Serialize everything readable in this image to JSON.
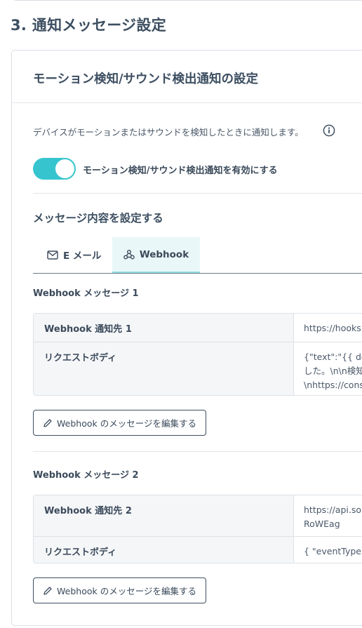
{
  "section": {
    "title": "3. 通知メッセージ設定"
  },
  "card": {
    "title": "モーション検知/サウンド検出通知の設定",
    "description": "デバイスがモーションまたはサウンドを検知したときに通知します。",
    "toggle": {
      "label": "モーション検知/サウンド検出通知を有効にする",
      "enabled": true
    },
    "message_heading": "メッセージ内容を設定する",
    "tabs": [
      {
        "label": "E メール",
        "icon": "mail-icon",
        "active": false
      },
      {
        "label": "Webhook",
        "icon": "webhook-icon",
        "active": true
      }
    ],
    "messages": [
      {
        "title": "Webhook メッセージ 1",
        "rows": [
          {
            "key": "Webhook 通知先 1",
            "value": "https://hooks."
          },
          {
            "key": "リクエストボディ",
            "value": "{\"text\":\"{{ devi\nした。\\n\\n検知\n\\nhttps://cons"
          }
        ],
        "edit_label": "Webhook のメッセージを編集する"
      },
      {
        "title": "Webhook メッセージ 2",
        "rows": [
          {
            "key": "Webhook 通知先 2",
            "value": "https://api.sor\nRoWEag"
          },
          {
            "key": "リクエストボディ",
            "value": "{ \"eventType\""
          }
        ],
        "edit_label": "Webhook のメッセージを編集する"
      }
    ]
  },
  "colors": {
    "accent": "#36c5cf",
    "tab_active_bg": "#eaf7f8",
    "text": "#3b4a5b"
  }
}
